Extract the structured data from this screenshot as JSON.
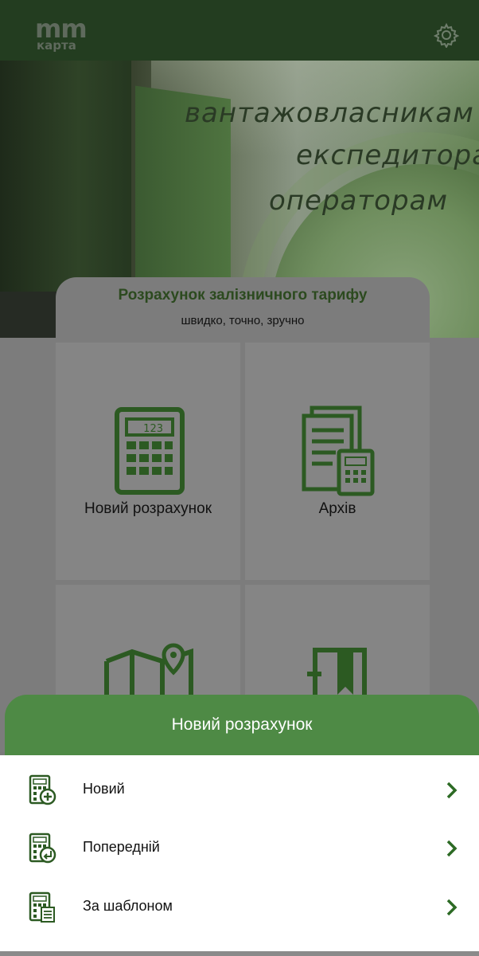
{
  "header": {
    "logo_top": "mm",
    "logo_bottom": "карта",
    "settings_icon": "gear-icon"
  },
  "banner": {
    "slogan_1": "вантажовласникам",
    "slogan_2": "експедиторам",
    "slogan_3": "операторам"
  },
  "card": {
    "title": "Розрахунок залізничного тарифу",
    "subtitle": "швидко, точно, зручно"
  },
  "tiles": [
    {
      "label": "Новий розрахунок",
      "icon": "calculator-icon"
    },
    {
      "label": "Архів",
      "icon": "archive-documents-icon"
    },
    {
      "label": "",
      "icon": "map-pin-icon"
    },
    {
      "label": "",
      "icon": "bookmark-book-icon"
    }
  ],
  "sheet": {
    "title": "Новий розрахунок",
    "items": [
      {
        "label": "Новий",
        "icon": "calculator-plus-icon"
      },
      {
        "label": "Попередній",
        "icon": "calculator-return-icon"
      },
      {
        "label": "За шаблоном",
        "icon": "calculator-list-icon"
      }
    ]
  },
  "colors": {
    "topbar": "#233d20",
    "accent_green": "#4e8a45",
    "icon_green": "#2c5a22",
    "overlay_gray": "#7c7c7c"
  }
}
